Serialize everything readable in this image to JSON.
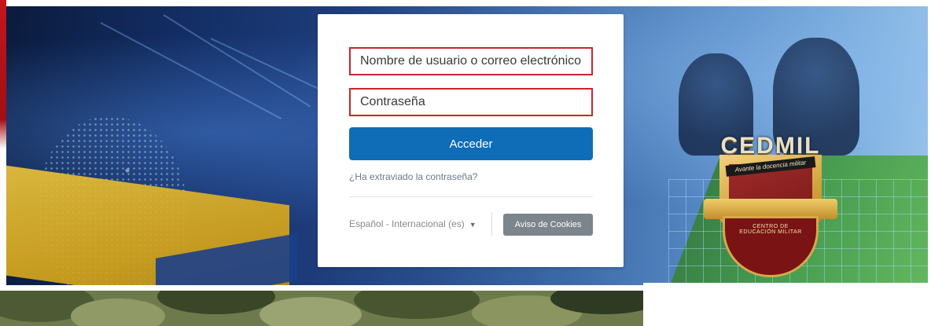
{
  "login": {
    "username_placeholder": "Nombre de usuario o correo electrónico",
    "password_placeholder": "Contraseña",
    "submit_label": "Acceder",
    "forgot_password": "¿Ha extraviado la contraseña?",
    "language": "Español - Internacional (es)",
    "cookies_label": "Aviso de Cookies"
  },
  "badge": {
    "title": "CEDMIL",
    "tagline": "Avante la docencia militar",
    "ring_text": "CENTRO DE EDUCACIÓN MILITAR"
  },
  "colors": {
    "accent_red": "#c8252c",
    "primary_blue": "#0f6cb6",
    "cookies_gray": "#7c848c"
  },
  "icons": {
    "language_dropdown": "chevron-down-icon"
  }
}
